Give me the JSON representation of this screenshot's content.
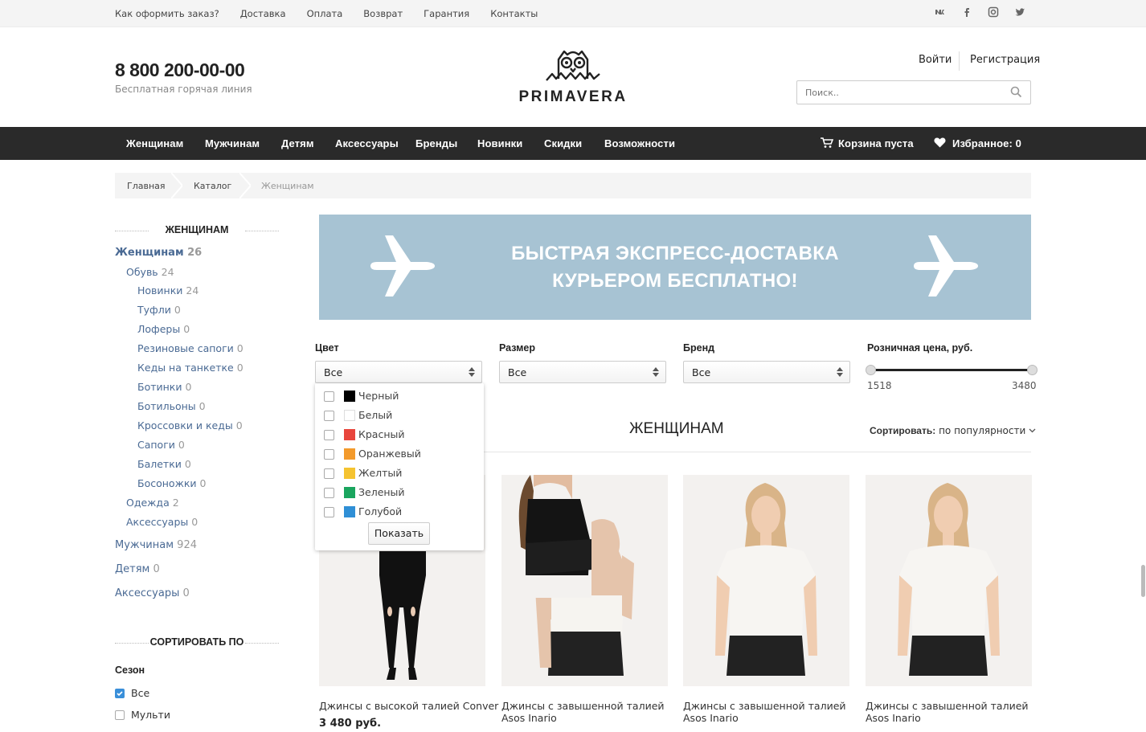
{
  "topbar": {
    "links": [
      "Как оформить заказ?",
      "Доставка",
      "Оплата",
      "Возврат",
      "Гарантия",
      "Контакты"
    ],
    "social": [
      "vk-icon",
      "facebook-icon",
      "instagram-icon",
      "twitter-icon"
    ]
  },
  "header": {
    "phone": "8 800 200-00-00",
    "phone_sub": "Бесплатная горячая линия",
    "logo_text": "PRIMAVERA",
    "login": "Войти",
    "register": "Регистрация",
    "search_placeholder": "Поиск.."
  },
  "nav": {
    "items": [
      "Женщинам",
      "Мужчинам",
      "Детям",
      "Аксессуары",
      "Бренды",
      "Новинки",
      "Скидки",
      "Возможности"
    ],
    "cart": "Корзина пуста",
    "favorites": "Избранное: 0"
  },
  "breadcrumb": [
    "Главная",
    "Каталог",
    "Женщинам"
  ],
  "sidebar": {
    "heading": "ЖЕНЩИНАМ",
    "categories": [
      {
        "label": "Женщинам",
        "count": "26"
      },
      {
        "label": "Обувь",
        "count": "24"
      },
      {
        "label": "Новинки",
        "count": "24"
      },
      {
        "label": "Туфли",
        "count": "0"
      },
      {
        "label": "Лоферы",
        "count": "0"
      },
      {
        "label": "Резиновые сапоги",
        "count": "0"
      },
      {
        "label": "Кеды на танкетке",
        "count": "0"
      },
      {
        "label": "Ботинки",
        "count": "0"
      },
      {
        "label": "Ботильоны",
        "count": "0"
      },
      {
        "label": "Кроссовки и кеды",
        "count": "0"
      },
      {
        "label": "Сапоги",
        "count": "0"
      },
      {
        "label": "Балетки",
        "count": "0"
      },
      {
        "label": "Босоножки",
        "count": "0"
      },
      {
        "label": "Одежда",
        "count": "2"
      },
      {
        "label": "Аксессуары",
        "count": "0"
      },
      {
        "label": "Мужчинам",
        "count": "924"
      },
      {
        "label": "Детям",
        "count": "0"
      },
      {
        "label": "Аксессуары",
        "count": "0"
      }
    ],
    "sort_heading": "СОРТИРОВАТЬ ПО",
    "season_heading": "Сезон",
    "season_options": [
      {
        "label": "Все",
        "checked": true
      },
      {
        "label": "Мульти",
        "checked": false
      }
    ]
  },
  "banner": {
    "line1": "БЫСТРАЯ ЭКСПРЕСС-ДОСТАВКА",
    "line2": "КУРЬЕРОМ БЕСПЛАТНО!"
  },
  "filters": {
    "color_label": "Цвет",
    "color_value": "Все",
    "size_label": "Размер",
    "size_value": "Все",
    "brand_label": "Бренд",
    "brand_value": "Все",
    "price_label": "Розничная цена, руб.",
    "price_min": "1518",
    "price_max": "3480",
    "color_options": [
      {
        "label": "Черный",
        "color": "#000000"
      },
      {
        "label": "Белый",
        "color": "#ffffff"
      },
      {
        "label": "Красный",
        "color": "#e8453c"
      },
      {
        "label": "Оранжевый",
        "color": "#f39a2b"
      },
      {
        "label": "Желтый",
        "color": "#f5c330"
      },
      {
        "label": "Зеленый",
        "color": "#1aa55e"
      },
      {
        "label": "Голубой",
        "color": "#2f8fd6"
      }
    ],
    "show_button": "Показать"
  },
  "section": {
    "title": "ЖЕНЩИНАМ",
    "sort_label": "Сортировать:",
    "sort_value": "по популярности"
  },
  "products": [
    {
      "name": "Джинсы с высокой талией Conver",
      "name2": "",
      "price": "3 480 руб."
    },
    {
      "name": "Джинсы с завышенной талией",
      "name2": "Asos Inario",
      "price": ""
    },
    {
      "name": "Джинсы с завышенной талией",
      "name2": "Asos Inario",
      "price": ""
    },
    {
      "name": "Джинсы с завышенной талией",
      "name2": "Asos Inario",
      "price": ""
    }
  ],
  "colors": {
    "nav_bg": "#2a2a2a",
    "link": "#4a6a94",
    "banner": "#a7c3d3",
    "checkbox_on": "#3a8fd9"
  }
}
